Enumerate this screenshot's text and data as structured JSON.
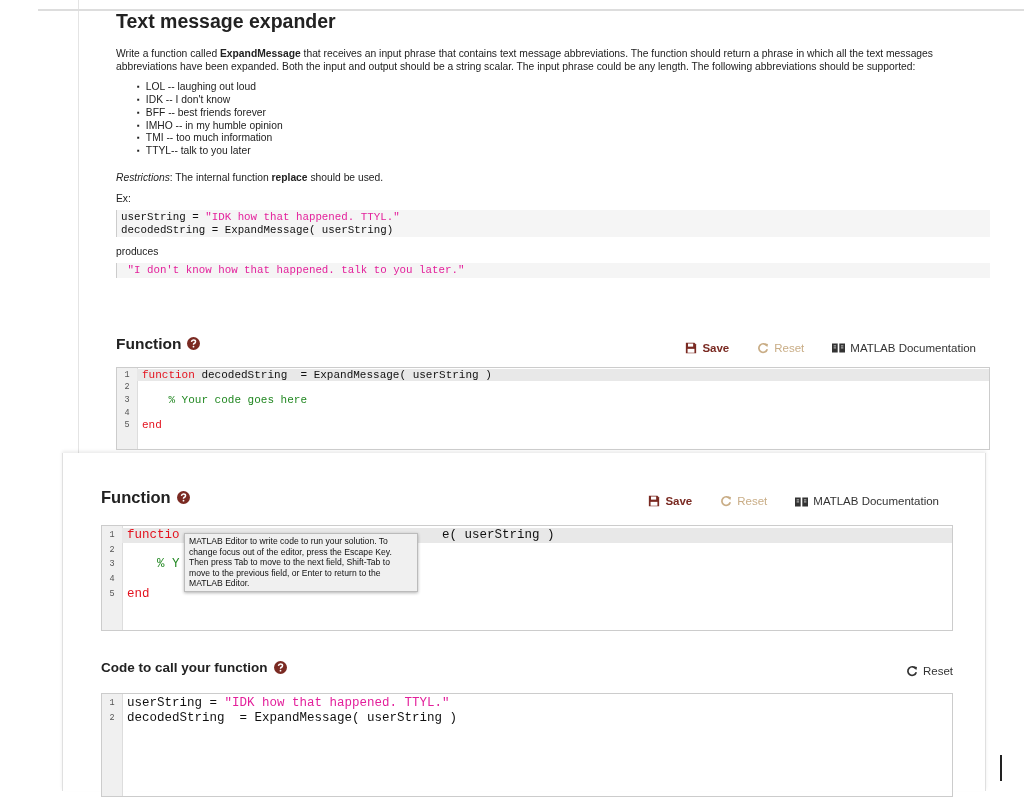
{
  "top_panel": {
    "title": "Text message expander",
    "intro": "Write a function called **ExpandMessage** that receives an input phrase that contains text message abbreviations. The function should return a phrase in which all the text messages abbreviations have been expanded. Both the input and output should be a string scalar. The input phrase could be any length.  The following abbreviations should be supported:",
    "abbreviations": [
      {
        "marker": "▪",
        "text": "LOL -- laughing out loud"
      },
      {
        "marker": "▪",
        "text": "IDK -- I don't know"
      },
      {
        "marker": "▪",
        "text": "BFF -- best friends forever"
      },
      {
        "marker": "▪",
        "text": "IMHO -- in my humble opinion"
      },
      {
        "marker": "▪",
        "text": "TMI --  too much information"
      },
      {
        "marker": "▪",
        "text": "TTYL--  talk to you later"
      }
    ],
    "restrictions": "*Restrictions*:  The internal function **replace** should be used.",
    "example_label": "Ex:",
    "example_code": [
      [
        {
          "kind": "plain",
          "text": "userString = "
        },
        {
          "kind": "string",
          "text": "\"IDK how that happened. TTYL.\""
        }
      ],
      [
        {
          "kind": "plain",
          "text": "decodedString = ExpandMessage( userString)"
        }
      ]
    ],
    "produces_label": "produces",
    "output_code": [
      [
        {
          "kind": "string",
          "text": " \"I don't know how that happened. talk to you later.\""
        }
      ]
    ],
    "function_section": {
      "heading": "Function",
      "toolbar": [
        {
          "kind": "save",
          "label": "Save"
        },
        {
          "kind": "reset",
          "label": "Reset",
          "disabled": true
        },
        {
          "kind": "docs",
          "label": "MATLAB Documentation"
        }
      ],
      "editor": [
        {
          "number": "1",
          "highlighted": true,
          "tokens": [
            {
              "kind": "keyword",
              "text": "function"
            },
            {
              "kind": "plain",
              "text": " decodedString  = ExpandMessage( userString )"
            }
          ]
        },
        {
          "number": "2",
          "highlighted": false
        },
        {
          "number": "3",
          "highlighted": false,
          "tokens": [
            {
              "kind": "comment",
              "text": "    % Your code goes here"
            }
          ]
        },
        {
          "number": "4",
          "highlighted": false
        },
        {
          "number": "5",
          "highlighted": false,
          "tokens": [
            {
              "kind": "keyword",
              "text": "end"
            }
          ]
        }
      ]
    }
  },
  "bottom_panel": {
    "function_section": {
      "heading": "Function",
      "toolbar": [
        {
          "kind": "save",
          "label": "Save"
        },
        {
          "kind": "reset",
          "label": "Reset",
          "disabled": true
        },
        {
          "kind": "docs",
          "label": "MATLAB Documentation"
        }
      ],
      "editor": [
        {
          "number": "1",
          "highlighted": true,
          "tokens": [
            {
              "kind": "keyword",
              "text": "functio"
            },
            {
              "kind": "gap"
            },
            {
              "kind": "plain",
              "text": "e( userString )"
            }
          ]
        },
        {
          "number": "2",
          "highlighted": false
        },
        {
          "number": "3",
          "highlighted": false,
          "tokens": [
            {
              "kind": "comment",
              "text": "    % Y"
            }
          ]
        },
        {
          "number": "4",
          "highlighted": false
        },
        {
          "number": "5",
          "highlighted": false,
          "tokens": [
            {
              "kind": "keyword",
              "text": "end"
            }
          ]
        }
      ],
      "tooltip": "MATLAB Editor to write code to run your solution. To change focus out of the editor, press the Escape Key. Then press Tab to move to the next field, Shift-Tab to move to the previous field, or Enter to return to the MATLAB Editor."
    },
    "caller_section": {
      "heading": "Code to call your function",
      "reset": {
        "label": "Reset",
        "disabled": false
      },
      "editor": [
        {
          "number": "1",
          "highlighted": false,
          "tokens": [
            {
              "kind": "plain",
              "text": "userString = "
            },
            {
              "kind": "string",
              "text": "\"IDK how that happened. TTYL.\""
            }
          ]
        },
        {
          "number": "2",
          "highlighted": false,
          "tokens": [
            {
              "kind": "plain",
              "text": "decodedString  = ExpandMessage( userString )"
            }
          ]
        }
      ]
    }
  }
}
